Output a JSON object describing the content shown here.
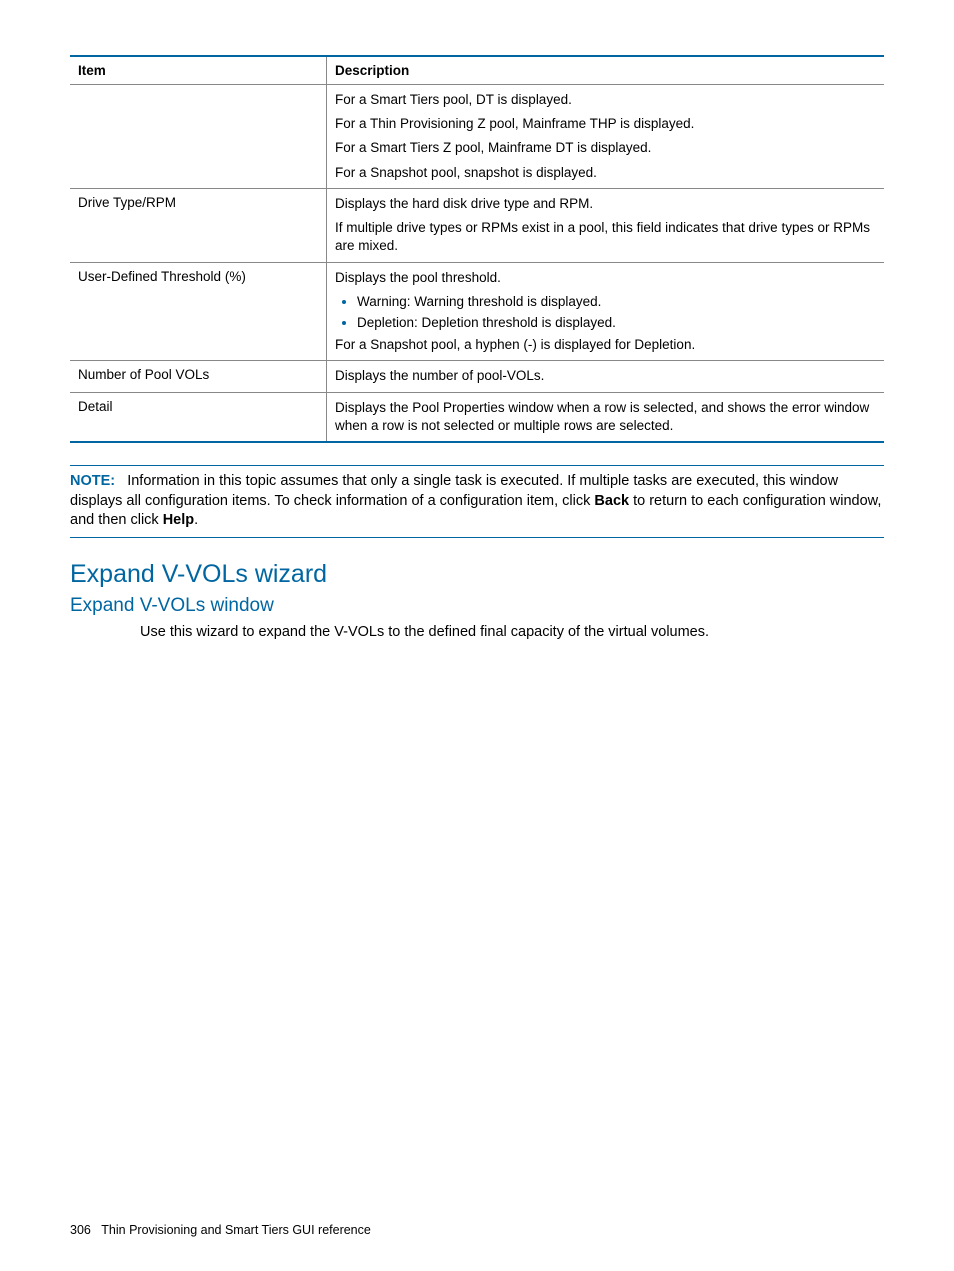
{
  "table": {
    "headers": {
      "item": "Item",
      "description": "Description"
    },
    "rows": [
      {
        "item": "",
        "lines": [
          "For a Smart Tiers pool, DT is displayed.",
          "For a Thin Provisioning Z pool, Mainframe THP is displayed.",
          "For a Smart Tiers Z pool, Mainframe DT is displayed.",
          "For a Snapshot pool, snapshot is displayed."
        ]
      },
      {
        "item": "Drive Type/RPM",
        "lines": [
          "Displays the hard disk drive type and RPM.",
          "If multiple drive types or RPMs exist in a pool, this field indicates that drive types or RPMs are mixed."
        ]
      },
      {
        "item": "User-Defined Threshold (%)",
        "intro": "Displays the pool threshold.",
        "bullets": [
          "Warning: Warning threshold is displayed.",
          "Depletion: Depletion threshold is displayed."
        ],
        "outro": "For a Snapshot pool, a hyphen (-) is displayed for Depletion."
      },
      {
        "item": "Number of Pool VOLs",
        "lines": [
          "Displays the number of pool-VOLs."
        ]
      },
      {
        "item": "Detail",
        "lines": [
          "Displays the Pool Properties window when a row is selected, and shows the error window when a row is not selected or multiple rows are selected."
        ]
      }
    ]
  },
  "note": {
    "label": "NOTE:",
    "text_parts": [
      "Information in this topic assumes that only a single task is executed. If multiple tasks are executed, this window displays all configuration items. To check information of a configuration item, click ",
      "Back",
      " to return to each configuration window, and then click ",
      "Help",
      "."
    ]
  },
  "headings": {
    "h1": "Expand V-VOLs wizard",
    "h2": "Expand V-VOLs window"
  },
  "body_text": "Use this wizard to expand the V-VOLs to the defined final capacity of the virtual volumes.",
  "footer": {
    "page": "306",
    "title": "Thin Provisioning and Smart Tiers GUI reference"
  }
}
